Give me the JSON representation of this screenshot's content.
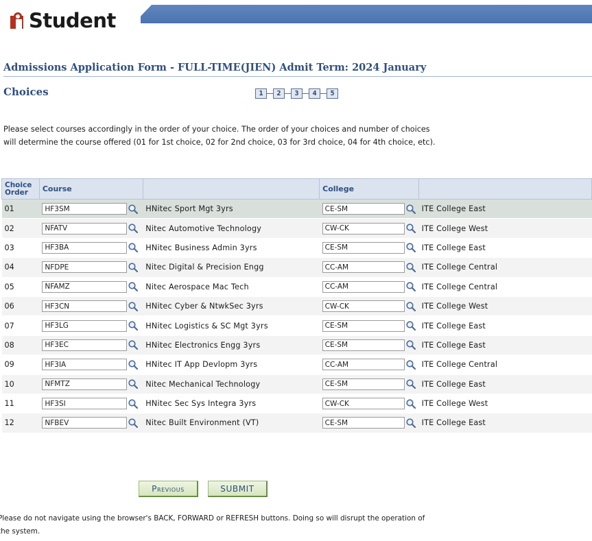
{
  "header": {
    "logo_text": "Student",
    "banner_color": "#5479b4"
  },
  "form": {
    "title": "Admissions Application Form - FULL-TIME(JIEN)   Admit Term: 2024 January",
    "page_title": "Choices",
    "steps": [
      "1",
      "2",
      "3",
      "4",
      "5"
    ],
    "instructions": "Please select courses accordingly in the order of your choice. The order of your choices and number of choices will determine the course offered (01 for 1st choice, 02 for 2nd choice, 03 for 3rd choice, 04 for 4th choice, etc)."
  },
  "grid": {
    "headers": {
      "choice_order": "Choice Order",
      "course": "Course",
      "description": "",
      "college": "College",
      "college_desc": ""
    },
    "rows": [
      {
        "order": "01",
        "course": "HF3SM",
        "course_desc": "HNitec Sport Mgt 3yrs",
        "college": "CE-SM",
        "college_desc": "ITE College East"
      },
      {
        "order": "02",
        "course": "NFATV",
        "course_desc": "Nitec Automotive Technology",
        "college": "CW-CK",
        "college_desc": "ITE College West"
      },
      {
        "order": "03",
        "course": "HF3BA",
        "course_desc": "HNitec Business Admin 3yrs",
        "college": "CE-SM",
        "college_desc": "ITE College East"
      },
      {
        "order": "04",
        "course": "NFDPE",
        "course_desc": "Nitec Digital & Precision Engg",
        "college": "CC-AM",
        "college_desc": "ITE College Central"
      },
      {
        "order": "05",
        "course": "NFAMZ",
        "course_desc": "Nitec Aerospace Mac Tech",
        "college": "CC-AM",
        "college_desc": "ITE College Central"
      },
      {
        "order": "06",
        "course": "HF3CN",
        "course_desc": "HNitec Cyber & NtwkSec 3yrs",
        "college": "CW-CK",
        "college_desc": "ITE College West"
      },
      {
        "order": "07",
        "course": "HF3LG",
        "course_desc": "HNitec Logistics & SC Mgt 3yrs",
        "college": "CE-SM",
        "college_desc": "ITE College East"
      },
      {
        "order": "08",
        "course": "HF3EC",
        "course_desc": "HNitec Electronics Engg 3yrs",
        "college": "CE-SM",
        "college_desc": "ITE College East"
      },
      {
        "order": "09",
        "course": "HF3IA",
        "course_desc": "HNitec IT App Devlopm 3yrs",
        "college": "CC-AM",
        "college_desc": "ITE College Central"
      },
      {
        "order": "10",
        "course": "NFMTZ",
        "course_desc": "Nitec Mechanical Technology",
        "college": "CE-SM",
        "college_desc": "ITE College East"
      },
      {
        "order": "11",
        "course": "HF3SI",
        "course_desc": "HNitec Sec Sys Integra 3yrs",
        "college": "CW-CK",
        "college_desc": "ITE College West"
      },
      {
        "order": "12",
        "course": "NFBEV",
        "course_desc": "Nitec Built Environment (VT)",
        "college": "CE-SM",
        "college_desc": "ITE College East"
      }
    ]
  },
  "buttons": {
    "previous": "Previous",
    "submit": "SUBMIT"
  },
  "footer": {
    "warning": "Please do not navigate using the browser's BACK, FORWARD or REFRESH buttons. Doing so will disrupt the operation of the system."
  },
  "icons": {
    "lookup": "magnifier-icon"
  }
}
